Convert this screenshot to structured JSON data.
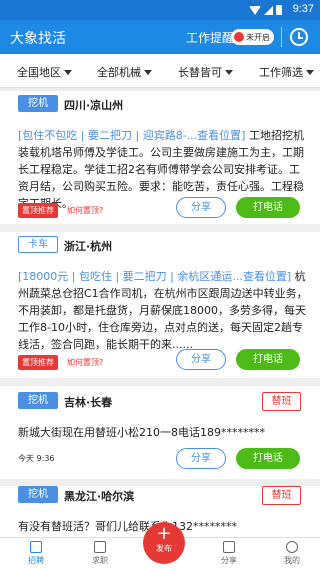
{
  "statusbar": {
    "time": "9:37"
  },
  "appbar": {
    "title": "大象找活",
    "alert_label": "工作提醒",
    "toggle_label": "未开启"
  },
  "filters": [
    {
      "label": "全国地区"
    },
    {
      "label": "全部机械"
    },
    {
      "label": "长替皆可"
    },
    {
      "label": "工作筛选"
    }
  ],
  "cards": [
    {
      "tag": "挖机",
      "location": "四川·凉山州",
      "desc_highlight": "[包住不包吃 | 要二把刀 |   迎宾路8-...查看位置]",
      "desc_text": " 工地招挖机装载机塔吊师傅及学徒工。公司主要做房建施工为主，工期长工程稳定。学徒工招2名有师傅带学会公司安排考证。工资月结，公司购买五险。要求：能吃苦，责任心强。工程稳定工期长。",
      "pin_label": "置顶推荐",
      "how_pin": "如何置顶?",
      "share": "分享",
      "call": "打电话"
    },
    {
      "tag": "卡车",
      "location": "浙江·杭州",
      "desc_highlight": "[18000元 | 包吃住 | 要二把刀 |   余杭区通运...查看位置]",
      "desc_text": " 杭州蔬菜总仓招C1合作司机，在杭州市区跟周边送中转业务，不用装卸，都是托盘货，月薪保底18000，多劳多得，每天工作8-10小时，住仓库旁边，点对点的送，每天固定2趟专线活，签合同跑，能长期干的来......",
      "pin_label": "置顶推荐",
      "how_pin": "如何置顶?",
      "share": "分享",
      "call": "打电话"
    },
    {
      "tag": "挖机",
      "location": "吉林·长春",
      "badge": "替班",
      "desc_text": "新城大街现在用替班小松210一8电话189********",
      "time": "今天 9:36",
      "share": "分享",
      "call": "打电话"
    },
    {
      "tag": "挖机",
      "location": "黑龙江·哈尔滨",
      "badge": "替班",
      "desc_text": "有没有替班活？哥们儿给联系你132********"
    }
  ],
  "bottomnav": {
    "items": [
      {
        "label": "招聘",
        "icon": "recruit-icon"
      },
      {
        "label": "求职",
        "icon": "resume-icon"
      },
      {
        "label": "分享",
        "icon": "share-icon"
      },
      {
        "label": "我的",
        "icon": "profile-icon"
      }
    ],
    "publish_label": "发布"
  },
  "colors": {
    "primary": "#1e88e5",
    "accent_red": "#e53935",
    "call_green": "#4cbb17",
    "tag_blue": "#4a90e2"
  }
}
